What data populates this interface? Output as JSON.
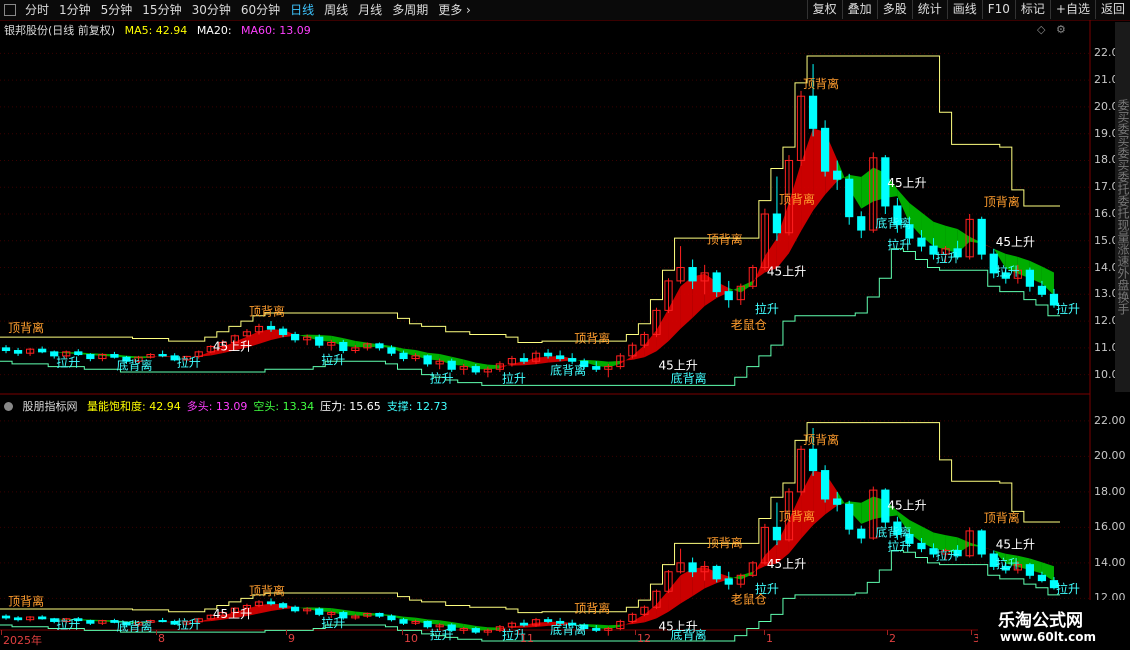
{
  "toolbar": {
    "periods": [
      {
        "label": "分时",
        "active": false
      },
      {
        "label": "1分钟",
        "active": false
      },
      {
        "label": "5分钟",
        "active": false
      },
      {
        "label": "15分钟",
        "active": false
      },
      {
        "label": "30分钟",
        "active": false
      },
      {
        "label": "60分钟",
        "active": false
      },
      {
        "label": "日线",
        "active": true
      },
      {
        "label": "周线",
        "active": false
      },
      {
        "label": "月线",
        "active": false
      },
      {
        "label": "多周期",
        "active": false
      },
      {
        "label": "更多",
        "active": false
      }
    ],
    "buttons": [
      "复权",
      "叠加",
      "多股",
      "统计",
      "画线",
      "F10",
      "标记",
      "+自选",
      "返回"
    ]
  },
  "main_pane": {
    "stock_title": "银邦股份(日线 前复权)",
    "ma5_label": "MA5: 42.94",
    "ma20_label": "MA20:",
    "ma60_label": "MA60: 13.09",
    "colors": {
      "ma5": "#ffff00",
      "ma20": "#ffffff",
      "ma60": "#ff40ff"
    }
  },
  "sub_pane": {
    "indicator_name": "股朋指标网",
    "params": [
      {
        "label": "量能饱和度: 42.94",
        "color": "#ffff00"
      },
      {
        "label": "多头: 13.09",
        "color": "#ff40ff"
      },
      {
        "label": "空头: 13.34",
        "color": "#40ff40"
      },
      {
        "label": "压力: 15.65",
        "color": "#ffffff"
      },
      {
        "label": "支撑: 12.73",
        "color": "#40ffff"
      }
    ]
  },
  "side_strip_text": "委买委买委买委托委托现量涨速外盘换手",
  "watermark": {
    "title": "乐淘公式网",
    "url": "www.60lt.com"
  },
  "time_axis": [
    "2025年",
    "8",
    "9",
    "10",
    "11",
    "12",
    "1",
    "2",
    "3"
  ],
  "chart_data": [
    {
      "type": "candlestick",
      "y_axis_ticks": [
        "22.00",
        "21.00",
        "20.00",
        "19.00",
        "18.00",
        "17.00",
        "16.00",
        "15.00",
        "14.00",
        "13.00",
        "12.00",
        "11.00",
        "10.00"
      ],
      "ylim": [
        9.5,
        22.5
      ],
      "candles": [
        [
          11.0,
          11.1,
          10.8,
          10.9
        ],
        [
          10.9,
          11.0,
          10.7,
          10.8
        ],
        [
          10.8,
          11.0,
          10.7,
          10.95
        ],
        [
          10.95,
          11.05,
          10.8,
          10.85
        ],
        [
          10.85,
          10.9,
          10.6,
          10.7
        ],
        [
          10.7,
          10.9,
          10.6,
          10.85
        ],
        [
          10.85,
          10.95,
          10.7,
          10.75
        ],
        [
          10.75,
          10.8,
          10.5,
          10.6
        ],
        [
          10.6,
          10.8,
          10.5,
          10.75
        ],
        [
          10.75,
          10.85,
          10.6,
          10.65
        ],
        [
          10.65,
          10.7,
          10.4,
          10.5
        ],
        [
          10.5,
          10.7,
          10.4,
          10.65
        ],
        [
          10.65,
          10.8,
          10.6,
          10.75
        ],
        [
          10.75,
          10.9,
          10.65,
          10.7
        ],
        [
          10.7,
          10.8,
          10.5,
          10.55
        ],
        [
          10.55,
          10.7,
          10.5,
          10.68
        ],
        [
          10.68,
          10.9,
          10.6,
          10.85
        ],
        [
          10.85,
          11.1,
          10.8,
          11.05
        ],
        [
          11.05,
          11.3,
          11.0,
          11.2
        ],
        [
          11.2,
          11.5,
          11.1,
          11.45
        ],
        [
          11.45,
          11.7,
          11.4,
          11.6
        ],
        [
          11.6,
          11.9,
          11.5,
          11.8
        ],
        [
          11.8,
          12.0,
          11.6,
          11.7
        ],
        [
          11.7,
          11.8,
          11.4,
          11.5
        ],
        [
          11.5,
          11.6,
          11.2,
          11.3
        ],
        [
          11.3,
          11.5,
          11.1,
          11.4
        ],
        [
          11.4,
          11.5,
          11.0,
          11.1
        ],
        [
          11.1,
          11.3,
          10.9,
          11.2
        ],
        [
          11.2,
          11.3,
          10.8,
          10.9
        ],
        [
          10.9,
          11.1,
          10.8,
          11.0
        ],
        [
          11.0,
          11.2,
          10.9,
          11.15
        ],
        [
          11.15,
          11.2,
          10.9,
          11.0
        ],
        [
          11.0,
          11.1,
          10.7,
          10.8
        ],
        [
          10.8,
          10.9,
          10.5,
          10.6
        ],
        [
          10.6,
          10.8,
          10.5,
          10.7
        ],
        [
          10.7,
          10.75,
          10.3,
          10.4
        ],
        [
          10.4,
          10.6,
          10.2,
          10.5
        ],
        [
          10.5,
          10.6,
          10.1,
          10.2
        ],
        [
          10.2,
          10.4,
          10.0,
          10.3
        ],
        [
          10.3,
          10.4,
          10.0,
          10.1
        ],
        [
          10.1,
          10.3,
          9.9,
          10.2
        ],
        [
          10.2,
          10.5,
          10.1,
          10.4
        ],
        [
          10.4,
          10.7,
          10.3,
          10.6
        ],
        [
          10.6,
          10.8,
          10.4,
          10.5
        ],
        [
          10.5,
          10.9,
          10.4,
          10.8
        ],
        [
          10.8,
          10.95,
          10.6,
          10.7
        ],
        [
          10.7,
          10.9,
          10.5,
          10.6
        ],
        [
          10.6,
          10.8,
          10.4,
          10.5
        ],
        [
          10.5,
          10.6,
          10.2,
          10.3
        ],
        [
          10.3,
          10.5,
          10.1,
          10.2
        ],
        [
          10.2,
          10.4,
          9.9,
          10.3
        ],
        [
          10.3,
          10.8,
          10.2,
          10.7
        ],
        [
          10.7,
          11.2,
          10.6,
          11.1
        ],
        [
          11.1,
          11.6,
          11.0,
          11.5
        ],
        [
          11.5,
          12.5,
          11.4,
          12.4
        ],
        [
          12.4,
          13.6,
          12.3,
          13.5
        ],
        [
          13.5,
          14.8,
          13.4,
          14.0
        ],
        [
          14.0,
          14.3,
          13.2,
          13.5
        ],
        [
          13.5,
          14.1,
          13.0,
          13.8
        ],
        [
          13.8,
          13.9,
          12.9,
          13.1
        ],
        [
          13.1,
          13.5,
          12.5,
          12.8
        ],
        [
          12.8,
          13.4,
          12.6,
          13.3
        ],
        [
          13.3,
          14.1,
          13.2,
          14.0
        ],
        [
          14.0,
          16.2,
          13.9,
          16.0
        ],
        [
          16.0,
          17.4,
          15.0,
          15.3
        ],
        [
          15.3,
          18.2,
          15.2,
          18.0
        ],
        [
          18.0,
          20.6,
          17.8,
          20.4
        ],
        [
          20.4,
          21.6,
          18.9,
          19.2
        ],
        [
          19.2,
          19.5,
          17.4,
          17.6
        ],
        [
          17.6,
          18.0,
          16.9,
          17.3
        ],
        [
          17.3,
          17.5,
          15.6,
          15.9
        ],
        [
          15.9,
          16.1,
          15.1,
          15.4
        ],
        [
          15.4,
          18.3,
          15.3,
          18.1
        ],
        [
          18.1,
          18.2,
          16.0,
          16.3
        ],
        [
          16.3,
          16.6,
          15.3,
          15.6
        ],
        [
          15.6,
          15.9,
          14.9,
          15.1
        ],
        [
          15.1,
          15.4,
          14.6,
          14.8
        ],
        [
          14.8,
          15.1,
          14.3,
          14.5
        ],
        [
          14.5,
          14.8,
          14.2,
          14.7
        ],
        [
          14.7,
          15.0,
          14.3,
          14.4
        ],
        [
          14.4,
          16.0,
          14.3,
          15.8
        ],
        [
          15.8,
          15.9,
          14.3,
          14.5
        ],
        [
          14.5,
          14.7,
          13.6,
          13.8
        ],
        [
          13.8,
          14.0,
          13.4,
          13.6
        ],
        [
          13.6,
          14.1,
          13.4,
          13.9
        ],
        [
          13.9,
          14.0,
          13.1,
          13.3
        ],
        [
          13.3,
          13.5,
          12.9,
          13.0
        ],
        [
          13.0,
          13.2,
          12.5,
          12.6
        ]
      ],
      "labels": [
        {
          "text": "顶背离",
          "index": 1,
          "price": 11.6,
          "color": "#ff9d2e"
        },
        {
          "text": "顶背离",
          "index": 21,
          "price": 12.2,
          "color": "#ff9d2e"
        },
        {
          "text": "顶背离",
          "index": 48,
          "price": 11.2,
          "color": "#ff9d2e"
        },
        {
          "text": "顶背离",
          "index": 59,
          "price": 14.9,
          "color": "#ff9d2e"
        },
        {
          "text": "顶背离",
          "index": 65,
          "price": 16.4,
          "color": "#ff9d2e"
        },
        {
          "text": "顶背离",
          "index": 67,
          "price": 20.7,
          "color": "#ff9d2e"
        },
        {
          "text": "顶背离",
          "index": 82,
          "price": 16.3,
          "color": "#ff9d2e"
        },
        {
          "text": "拉升",
          "index": 5,
          "price": 10.3,
          "color": "#40ffff"
        },
        {
          "text": "拉升",
          "index": 15,
          "price": 10.3,
          "color": "#40ffff"
        },
        {
          "text": "拉升",
          "index": 27,
          "price": 10.4,
          "color": "#40ffff"
        },
        {
          "text": "拉升",
          "index": 36,
          "price": 9.7,
          "color": "#40ffff"
        },
        {
          "text": "拉升",
          "index": 42,
          "price": 9.7,
          "color": "#40ffff"
        },
        {
          "text": "拉升",
          "index": 63,
          "price": 12.3,
          "color": "#40ffff"
        },
        {
          "text": "拉升",
          "index": 74,
          "price": 14.7,
          "color": "#40ffff"
        },
        {
          "text": "拉升",
          "index": 78,
          "price": 14.2,
          "color": "#40ffff"
        },
        {
          "text": "拉升",
          "index": 83,
          "price": 13.7,
          "color": "#40ffff"
        },
        {
          "text": "拉升",
          "index": 88,
          "price": 12.3,
          "color": "#40ffff"
        },
        {
          "text": "45上升",
          "index": 18,
          "price": 10.9,
          "color": "#ffffff"
        },
        {
          "text": "45上升",
          "index": 55,
          "price": 10.2,
          "color": "#ffffff"
        },
        {
          "text": "45上升",
          "index": 64,
          "price": 13.7,
          "color": "#ffffff"
        },
        {
          "text": "45上升",
          "index": 74,
          "price": 17.0,
          "color": "#ffffff"
        },
        {
          "text": "45上升",
          "index": 83,
          "price": 14.8,
          "color": "#ffffff"
        },
        {
          "text": "底背离",
          "index": 10,
          "price": 10.2,
          "color": "#40ffff"
        },
        {
          "text": "底背离",
          "index": 46,
          "price": 10.0,
          "color": "#40ffff"
        },
        {
          "text": "底背离",
          "index": 56,
          "price": 9.7,
          "color": "#40ffff"
        },
        {
          "text": "底背离",
          "index": 73,
          "price": 15.5,
          "color": "#40ffff"
        },
        {
          "text": "老鼠仓",
          "index": 61,
          "price": 11.7,
          "color": "#ff9d2e"
        }
      ],
      "resistance_line": "upper step line (pressure)",
      "support_line": "lower line (support)"
    },
    {
      "type": "candlestick",
      "y_axis_ticks": [
        "22.00",
        "20.00",
        "18.00",
        "16.00",
        "14.00",
        "12.00"
      ],
      "ylim": [
        10.5,
        22.5
      ]
    }
  ]
}
